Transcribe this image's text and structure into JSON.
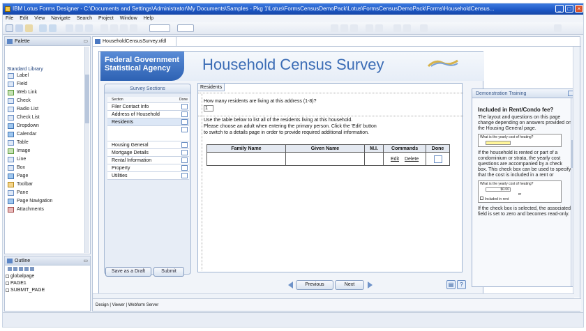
{
  "window": {
    "title": "IBM Lotus Forms Designer - C:\\Documents and Settings\\Administrator\\My Documents\\Samples - Pkg 1\\Lotus\\FormsCensusDemoPack\\Lotus\\FormsCensusDemoPack\\Forms\\HouseholdCensus..."
  },
  "menubar": {
    "items": [
      "File",
      "Edit",
      "View",
      "Navigate",
      "Search",
      "Project",
      "Window",
      "Help"
    ]
  },
  "palette": {
    "title": "Palette",
    "group": "Standard Library",
    "items": [
      {
        "label": "Label",
        "icon": "label-icon"
      },
      {
        "label": "Field",
        "icon": "field-icon"
      },
      {
        "label": "Web Link",
        "icon": "web-link-icon"
      },
      {
        "label": "Check",
        "icon": "check-icon"
      },
      {
        "label": "Radio List",
        "icon": "radio-list-icon"
      },
      {
        "label": "Check List",
        "icon": "check-list-icon"
      },
      {
        "label": "Dropdown",
        "icon": "dropdown-icon"
      },
      {
        "label": "Calendar",
        "icon": "calendar-icon"
      },
      {
        "label": "Table",
        "icon": "table-icon"
      },
      {
        "label": "Image",
        "icon": "image-icon"
      },
      {
        "label": "Line",
        "icon": "line-icon"
      },
      {
        "label": "Box",
        "icon": "box-icon"
      },
      {
        "label": "Page",
        "icon": "page-icon"
      },
      {
        "label": "Toolbar",
        "icon": "toolbar-icon"
      },
      {
        "label": "Pane",
        "icon": "pane-icon"
      },
      {
        "label": "Page Navigation",
        "icon": "page-navigation-icon"
      },
      {
        "label": "Attachments",
        "icon": "attachments-icon"
      }
    ]
  },
  "outline": {
    "title": "Outline",
    "items": [
      "globalpage",
      "PAGE1",
      "SUBMIT_PAGE"
    ]
  },
  "editor": {
    "tab": "HouseholdCensusSurvey.xfdl",
    "modes": "Design | Viewer | Webform Server"
  },
  "form": {
    "agency_line1": "Federal Government",
    "agency_line2": "Statistical Agency",
    "title": "Household Census Survey",
    "sections_title": "Survey Sections",
    "sections_col_section": "Section",
    "sections_col_done": "Done",
    "sections": [
      {
        "label": "Filer Contact Info",
        "selected": false
      },
      {
        "label": "Address of Household",
        "selected": false
      },
      {
        "label": "Residents",
        "selected": true
      },
      {
        "label": "",
        "selected": false
      },
      {
        "label": "Housing General",
        "selected": false
      },
      {
        "label": "Mortgage Details",
        "selected": false
      },
      {
        "label": "Rental Information",
        "selected": false
      },
      {
        "label": "Property",
        "selected": false
      },
      {
        "label": "Utilities",
        "selected": false
      }
    ],
    "save_draft": "Save as a Draft",
    "submit": "Submit",
    "residents_tab": "Residents",
    "question": "How many residents are living at this address (1-8)?",
    "question_value": "1",
    "instructions_1": "Use the table below to list all of the residents living at this household.",
    "instructions_2": "Please choose an adult when entering the primary person.  Click the 'Edit' button",
    "instructions_3": "to switch to a details page in order to provide required additional information.",
    "table_headers": [
      "Family Name",
      "Given Name",
      "M.I.",
      "Commands",
      "Done"
    ],
    "edit_link": "Edit",
    "delete_link": "Delete",
    "previous": "Previous",
    "next": "Next",
    "help_button": "?"
  },
  "help": {
    "title": "Demonstration Training",
    "heading": "Included in Rent/Condo fee?",
    "para1": "The layout and questions on this page change depending on answers provided on the Housing General page.",
    "mini1_label": "What is the yearly cost of heating?",
    "para2": "If the household is rented or part of a condominium or strata, the yearly cost questions are accompanied by a check box.  This check box can be used to specify that the cost is included in a rent or",
    "mini2_label": "What is the yearly cost of heating?",
    "mini2_value": "$0.00",
    "mini2_or": "or",
    "mini2_check": "Included in rent",
    "para3": "If the check box is selected, the associated field is set to zero and becomes read-only."
  }
}
